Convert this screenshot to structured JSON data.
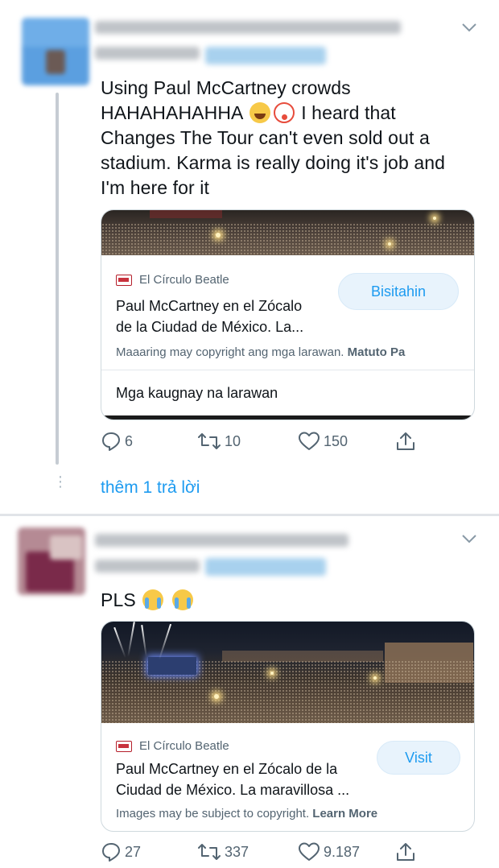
{
  "tweet1": {
    "text_line1": "Using Paul McCartney crowds",
    "text_line2_pre": "HAHAHAHAHHA",
    "text_line2_post": "I heard that",
    "text_line3": "Changes The Tour can't even sold out a",
    "text_line4": "stadium. Karma is really doing it's job and",
    "text_line5": "I'm here for it",
    "emojis": [
      "face-with-tears-of-joy",
      "clown-face"
    ],
    "card": {
      "source": "El Círculo Beatle",
      "title_line1": "Paul McCartney en el Zócalo",
      "title_line2": "de la Ciudad de México. La...",
      "button": "Bisitahin",
      "copyright_text": "Maaaring may copyright ang mga larawan.",
      "copyright_link": "Matuto Pa",
      "related": "Mga kaugnay na larawan"
    },
    "actions": {
      "replies": "6",
      "retweets": "10",
      "likes": "150"
    },
    "more_replies": "thêm 1 trả lời"
  },
  "tweet2": {
    "text": "PLS",
    "emojis": [
      "loudly-crying-face",
      "loudly-crying-face"
    ],
    "card": {
      "source": "El Círculo Beatle",
      "title_line1": "Paul McCartney en el Zócalo de la",
      "title_line2": "Ciudad de México. La maravillosa ...",
      "button": "Visit",
      "copyright_text": "Images may be subject to copyright.",
      "copyright_link": "Learn More"
    },
    "actions": {
      "replies": "27",
      "retweets": "337",
      "likes": "9.187"
    }
  },
  "colors": {
    "accent": "#1d9bf0",
    "muted": "#536471",
    "border": "#cfd9de",
    "button_bg": "#e8f3fc"
  }
}
